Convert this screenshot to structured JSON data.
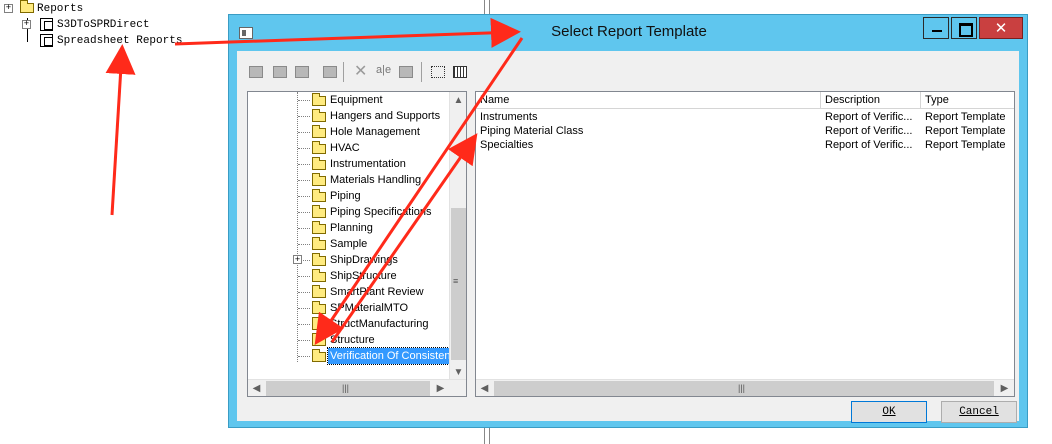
{
  "background_tree": {
    "root": "Reports",
    "items": [
      "S3DToSPRDirect",
      "Spreadsheet Reports"
    ]
  },
  "dialog": {
    "title": "Select Report Template",
    "close_glyph": "✕",
    "buttons": {
      "ok": "OK",
      "cancel": "Cancel"
    }
  },
  "toolbar": {
    "icons": [
      "new-folder-icon",
      "new-item-icon",
      "copy-icon",
      "paste-icon",
      "delete-icon",
      "rename-icon",
      "properties-icon",
      "list-view-icon",
      "details-view-icon"
    ],
    "rename_glyph": "a|e",
    "delete_glyph": "✕"
  },
  "folder_tree": {
    "items": [
      "Equipment",
      "Hangers and Supports",
      "Hole Management",
      "HVAC",
      "Instrumentation",
      "Materials Handling",
      "Piping",
      "Piping Specifications",
      "Planning",
      "Sample",
      "ShipDrawings",
      "ShipStructure",
      "SmartPlant Review",
      "SPMaterialMTO",
      "StructManufacturing",
      "Structure",
      "Verification Of Consistency"
    ],
    "selected": "Verification Of Consistency",
    "expandable": "ShipDrawings"
  },
  "report_list": {
    "columns": [
      "Name",
      "Description",
      "Type"
    ],
    "rows": [
      [
        "Instruments",
        "Report of Verific...",
        "Report Template"
      ],
      [
        "Piping Material Class",
        "Report of Verific...",
        "Report Template"
      ],
      [
        "Specialties",
        "Report of Verific...",
        "Report Template"
      ]
    ]
  },
  "glyphs": {
    "up": "▲",
    "down": "▼",
    "left": "◀",
    "right": "▶",
    "grip_h": "|||",
    "grip_v": "≡",
    "plus": "+"
  },
  "colors": {
    "title_bar": "#5fc6ee",
    "close_button": "#c94040",
    "selection": "#3399ff",
    "annotation_arrow": "#ff2a1a"
  }
}
